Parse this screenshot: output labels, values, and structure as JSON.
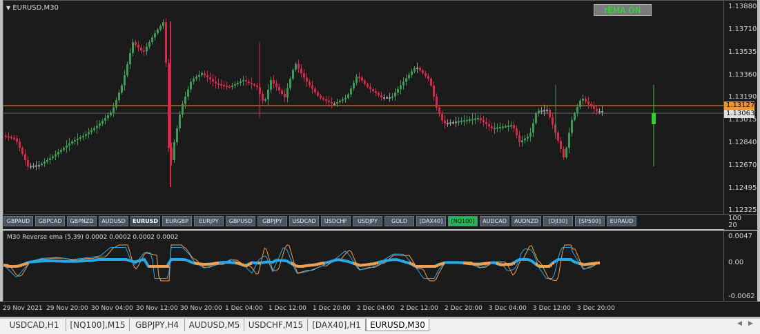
{
  "chart": {
    "symbol_title": "EURUSD,M30",
    "indicator_button": "rEMA ON",
    "price_levels": [
      "1.13880",
      "1.13710",
      "1.13535",
      "1.13360",
      "1.13190",
      "1.13015",
      "1.12840",
      "1.12670",
      "1.12495",
      "1.12325"
    ],
    "current_price_tag": "1.13127",
    "bid_price_tag": "1.13063",
    "volume_axis": [
      "100",
      "20"
    ],
    "symbol_buttons": [
      "GBPAUD",
      "GBPCAD",
      "GBPNZD",
      "AUDUSD",
      "EURUSD",
      "EURGBP",
      "EURJPY",
      "GBPUSD",
      "GBPJPY",
      "USDCAD",
      "USDCHF",
      "USDJPY",
      "GOLD",
      "[DAX40]",
      "[NQ100]",
      "AUDCAD",
      "AUDNZD",
      "[DJI30]",
      "[SP500]",
      "EURAUD"
    ],
    "active_symbol": "EURUSD",
    "highlight_symbol": "[NQ100]",
    "indicator_label": "M30 Reverse ema (5,39) 0.0002 0.0002 0.0002 0.0002",
    "indicator_levels": [
      "0.0047",
      "0.00",
      "-0.0062"
    ],
    "time_labels": [
      "29 Nov 2021",
      "29 Nov 20:00",
      "30 Nov 04:00",
      "30 Nov 12:00",
      "30 Nov 20:00",
      "1 Dec 04:00",
      "1 Dec 12:00",
      "1 Dec 20:00",
      "2 Dec 04:00",
      "2 Dec 12:00",
      "2 Dec 20:00",
      "3 Dec 04:00",
      "3 Dec 12:00",
      "3 Dec 20:00"
    ],
    "colors": {
      "bull": "#3d9a57",
      "bear": "#d6284a",
      "neutral": "#9a9a9a",
      "price_line": "#f0922e",
      "ema_blue": "#29a8e8",
      "ema_orange": "#f4a04c",
      "button_green": "#2bb35c"
    }
  },
  "tabs": [
    "USDCAD,H1",
    "[NQ100],M15",
    "GBPJPY,H4",
    "AUDUSD,M5",
    "USDCHF,M15",
    "[DAX40],H1",
    "EURUSD,M30"
  ],
  "active_tab": "EURUSD,M30",
  "scroll": {
    "left_icon": "scroll-left-icon",
    "right_icon": "scroll-right-icon"
  }
}
